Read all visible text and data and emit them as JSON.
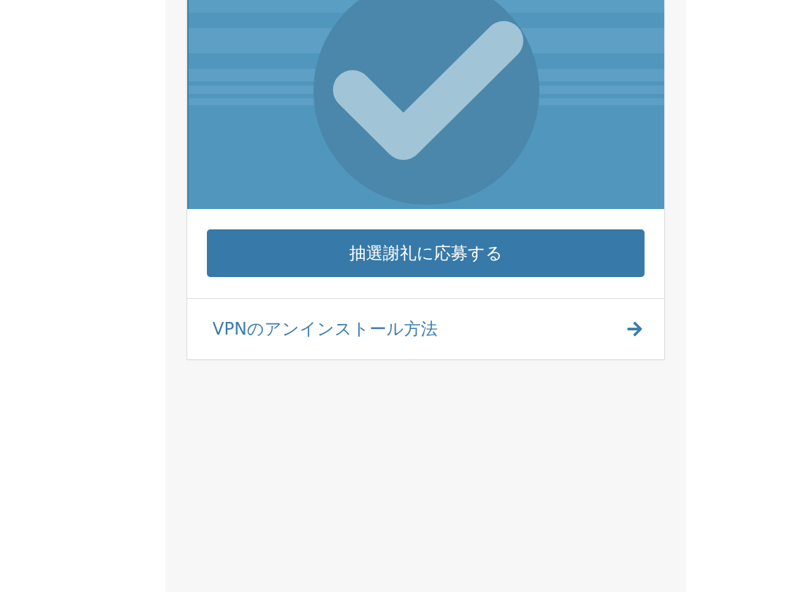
{
  "card": {
    "button": {
      "label": "抽選謝礼に応募する"
    },
    "link": {
      "label": "VPNのアンインストール方法"
    }
  }
}
